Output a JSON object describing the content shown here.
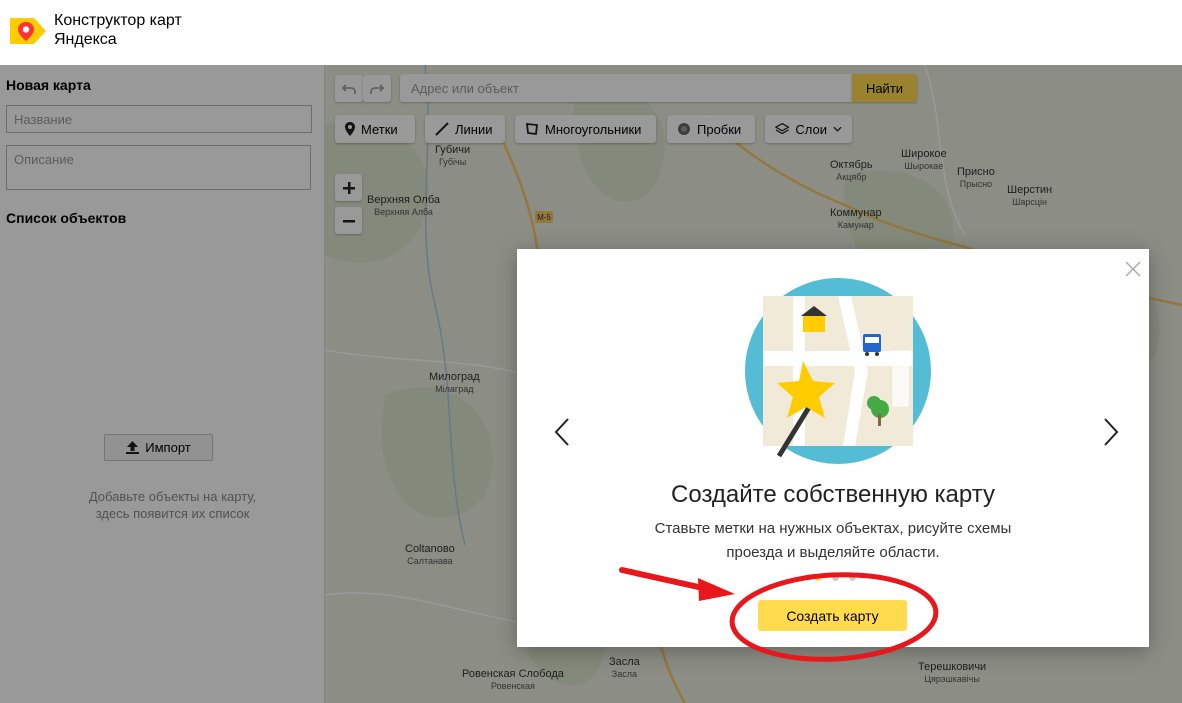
{
  "app": {
    "title_line1": "Конструктор карт",
    "title_line2": "Яндекса",
    "logo_icon": "map-pin-logo-icon",
    "brand_color": "#ffcc00"
  },
  "sidebar": {
    "map_title": "Новая карта",
    "name_placeholder": "Название",
    "description_placeholder": "Описание",
    "objects_title": "Список объектов",
    "import_label": "Импорт",
    "empty_hint_line1": "Добавьте объекты на карту,",
    "empty_hint_line2": "здесь появится их список"
  },
  "search": {
    "placeholder": "Адрес или объект",
    "button": "Найти"
  },
  "tools": {
    "points": "Метки",
    "lines": "Линии",
    "polygons": "Многоугольники",
    "traffic": "Пробки",
    "layers": "Слои"
  },
  "map": {
    "towns": [
      {
        "name": "Губичи",
        "sub": "Губічы"
      },
      {
        "name": "Верхняя Олба",
        "sub": "Верхняя Алба"
      },
      {
        "name": "Октябрь",
        "sub": "Акцябр"
      },
      {
        "name": "Широкое",
        "sub": "Шырокае"
      },
      {
        "name": "Присно",
        "sub": "Прыснo"
      },
      {
        "name": "Шерстин",
        "sub": "Шарсцін"
      },
      {
        "name": "Коммунар",
        "sub": "Камунар"
      },
      {
        "name": "Милоград",
        "sub": "Мілаград"
      },
      {
        "name": "Соltanово",
        "sub": "Салтанава"
      },
      {
        "name": "Засла",
        "sub": "Засла"
      },
      {
        "name": "Ровенская Слобода",
        "sub": "Ровенская"
      },
      {
        "name": "Терешковичи",
        "sub": "Цярэшкавічы"
      }
    ],
    "road_label": "М-5",
    "colors": {
      "land": "#e8ecdf",
      "water": "#a9cbe5",
      "road": "#f6c767"
    }
  },
  "modal": {
    "title": "Создайте собственную карту",
    "text_line1": "Ставьте метки на нужных объектах, рисуйте схемы",
    "text_line2": "проезда и выделяйте области.",
    "button": "Создать карту",
    "pages_total": 3,
    "page_current": 1,
    "accent": "#ffdb4d"
  }
}
